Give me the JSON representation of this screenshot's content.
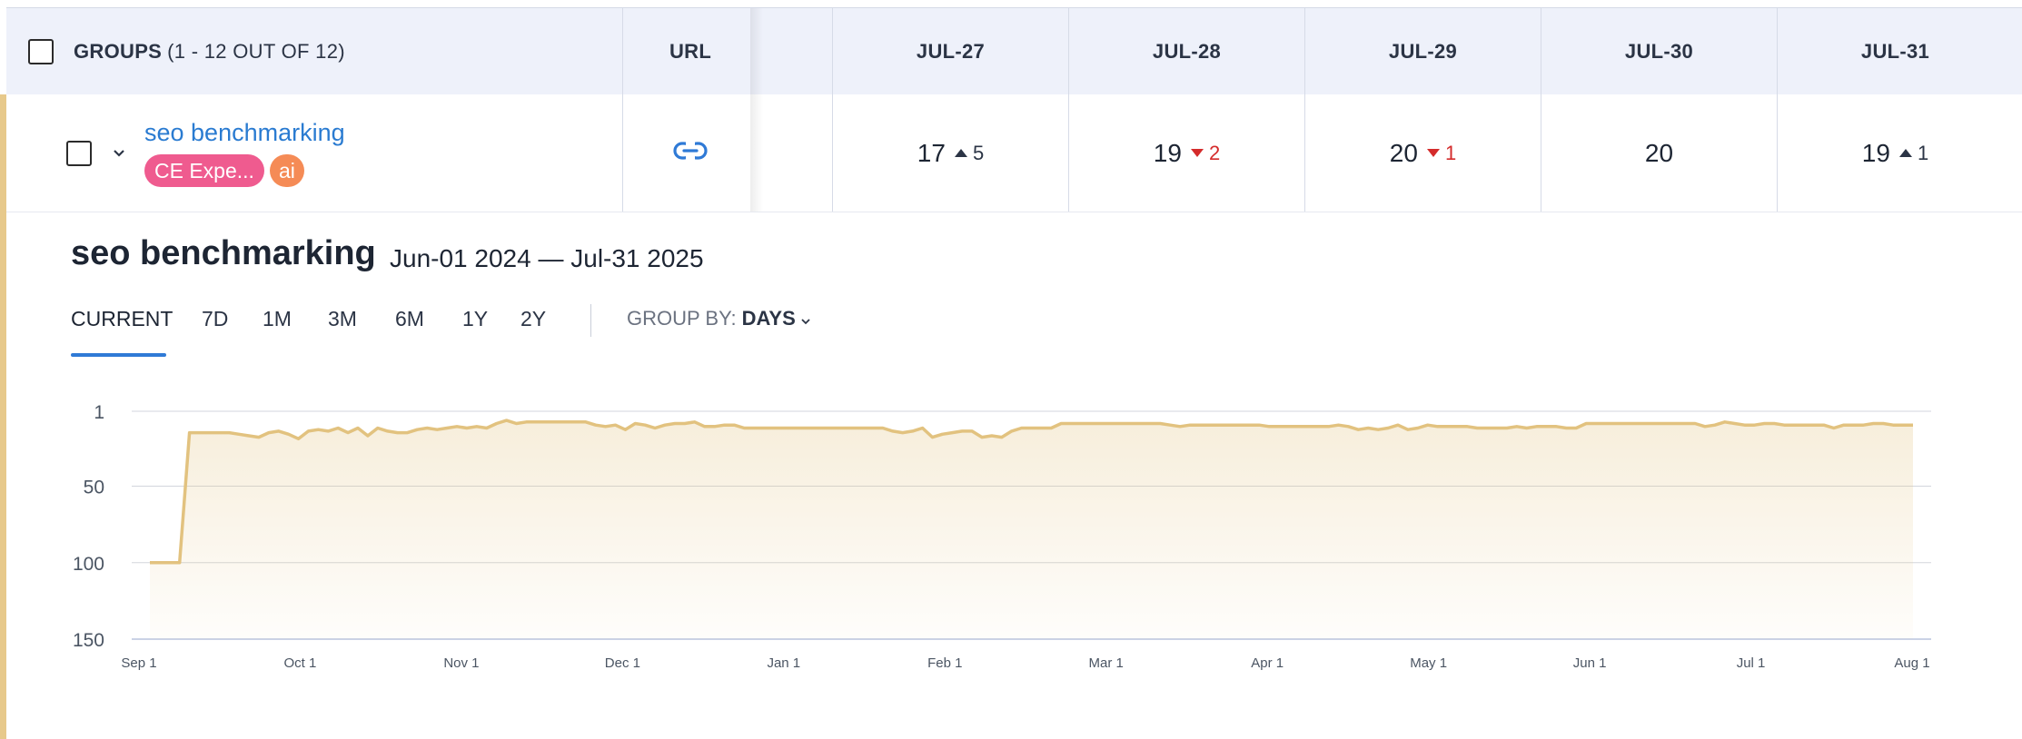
{
  "header": {
    "groups_label": "GROUPS",
    "groups_count": "(1 - 12 OUT OF 12)",
    "url_label": "URL",
    "dates": [
      "JUL-27",
      "JUL-28",
      "JUL-29",
      "JUL-30",
      "JUL-31"
    ]
  },
  "row": {
    "name": "seo benchmarking",
    "tags": [
      {
        "label": "CE Expe...",
        "color": "#ef5b8f"
      },
      {
        "label": "ai",
        "color": "#f58b56"
      }
    ],
    "icons": {
      "expand": "chevron-down-icon",
      "url": "link-icon"
    },
    "ranks": [
      {
        "value": "17",
        "delta": "5",
        "dir": "up"
      },
      {
        "value": "19",
        "delta": "2",
        "dir": "down"
      },
      {
        "value": "20",
        "delta": "1",
        "dir": "down"
      },
      {
        "value": "20",
        "delta": "",
        "dir": ""
      },
      {
        "value": "19",
        "delta": "1",
        "dir": "up"
      }
    ]
  },
  "panel": {
    "title": "seo benchmarking",
    "range": "Jun-01 2024 — Jul-31 2025",
    "tabs": [
      "CURRENT",
      "7D",
      "1M",
      "3M",
      "6M",
      "1Y",
      "2Y"
    ],
    "active_tab": "CURRENT",
    "group_by_label": "GROUP BY:",
    "group_by_value": "DAYS"
  },
  "colors": {
    "accent": "#2f7ad6",
    "line": "#e2c27f",
    "up": "#2b3445",
    "down": "#d42b2b"
  },
  "chart_data": {
    "type": "area",
    "title": "",
    "xlabel": "",
    "ylabel": "",
    "y_reversed": true,
    "ylim": [
      1,
      150
    ],
    "y_ticks": [
      1,
      50,
      100,
      150
    ],
    "x_tick_labels": [
      "Sep 1",
      "Oct 1",
      "Nov 1",
      "Dec 1",
      "Jan 1",
      "Feb 1",
      "Mar 1",
      "Apr 1",
      "May 1",
      "Jun 1",
      "Jul 1",
      "Aug 1"
    ],
    "grid": true,
    "series": [
      {
        "values": [
          100,
          100,
          100,
          100,
          15,
          15,
          15,
          15,
          15,
          16,
          17,
          18,
          15,
          14,
          16,
          19,
          14,
          13,
          14,
          12,
          15,
          12,
          17,
          12,
          14,
          15,
          15,
          13,
          12,
          13,
          12,
          11,
          12,
          11,
          12,
          9,
          7,
          9,
          8,
          8,
          8,
          8,
          8,
          8,
          8,
          10,
          11,
          10,
          13,
          9,
          10,
          12,
          10,
          9,
          9,
          8,
          11,
          11,
          10,
          10,
          12,
          12,
          12,
          12,
          12,
          12,
          12,
          12,
          12,
          12,
          12,
          12,
          12,
          12,
          12,
          14,
          15,
          14,
          12,
          18,
          16,
          15,
          14,
          14,
          18,
          17,
          18,
          14,
          12,
          12,
          12,
          12,
          9,
          9,
          9,
          9,
          9,
          9,
          9,
          9,
          9,
          9,
          9,
          10,
          11,
          10,
          10,
          10,
          10,
          10,
          10,
          10,
          10,
          11,
          11,
          11,
          11,
          11,
          11,
          11,
          10,
          11,
          13,
          12,
          13,
          12,
          10,
          13,
          12,
          10,
          11,
          11,
          11,
          11,
          12,
          12,
          12,
          12,
          11,
          12,
          11,
          11,
          11,
          12,
          12,
          9,
          9,
          9,
          9,
          9,
          9,
          9,
          9,
          9,
          9,
          9,
          9,
          11,
          10,
          8,
          9,
          10,
          10,
          9,
          9,
          10,
          10,
          10,
          10,
          10,
          12,
          10,
          10,
          10,
          9,
          9,
          10,
          10,
          10
        ]
      }
    ]
  }
}
